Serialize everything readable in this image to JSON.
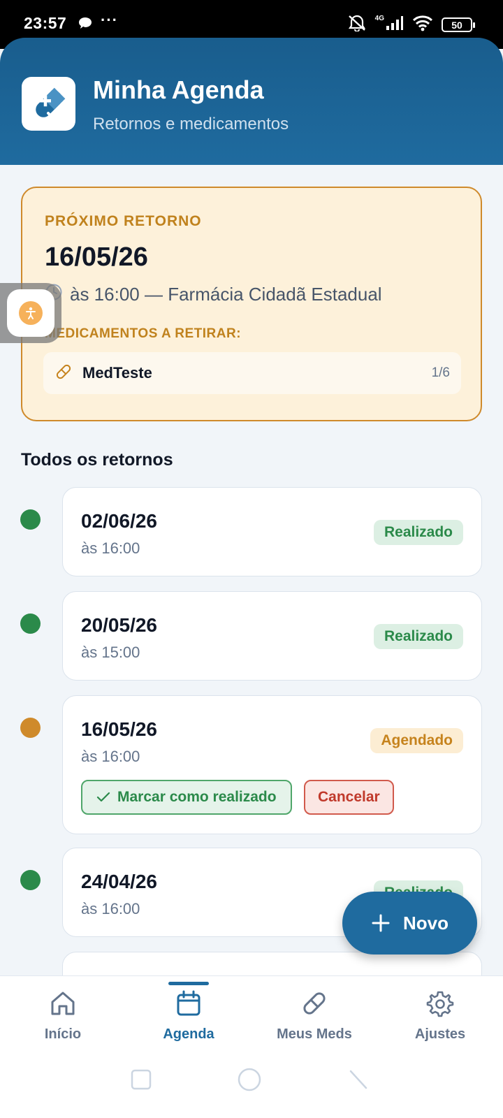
{
  "status_bar": {
    "time": "23:57",
    "dots": "···",
    "network": "4G",
    "battery": "50"
  },
  "header": {
    "title": "Minha Agenda",
    "subtitle": "Retornos e medicamentos"
  },
  "next_return": {
    "label": "PRÓXIMO RETORNO",
    "date": "16/05/26",
    "time_place": "às 16:00 — Farmácia Cidadã Estadual",
    "meds_label": "MEDICAMENTOS A RETIRAR:",
    "meds": [
      {
        "name": "MedTeste",
        "count": "1/6"
      }
    ]
  },
  "section_title": "Todos os retornos",
  "returns": [
    {
      "date": "02/06/26",
      "time": "às 16:00",
      "status": "Realizado",
      "status_color": "#2b8a4a"
    },
    {
      "date": "20/05/26",
      "time": "às 15:00",
      "status": "Realizado",
      "status_color": "#2b8a4a"
    },
    {
      "date": "16/05/26",
      "time": "às 16:00",
      "status": "Agendado",
      "status_color": "#c6831d",
      "mark_done_label": "Marcar como realizado",
      "cancel_label": "Cancelar"
    },
    {
      "date": "24/04/26",
      "time": "às 16:00",
      "status": "Realizado",
      "status_color": "#2b8a4a"
    }
  ],
  "fab": {
    "label": "Novo"
  },
  "nav": [
    {
      "label": "Início",
      "icon": "home-icon"
    },
    {
      "label": "Agenda",
      "icon": "calendar-icon",
      "active": true
    },
    {
      "label": "Meus Meds",
      "icon": "pill-icon"
    },
    {
      "label": "Ajustes",
      "icon": "gear-icon"
    }
  ],
  "colors": {
    "primary": "#1f6b9f",
    "accent": "#cf8a2b",
    "success": "#2b8a4a",
    "danger": "#c0392b"
  }
}
